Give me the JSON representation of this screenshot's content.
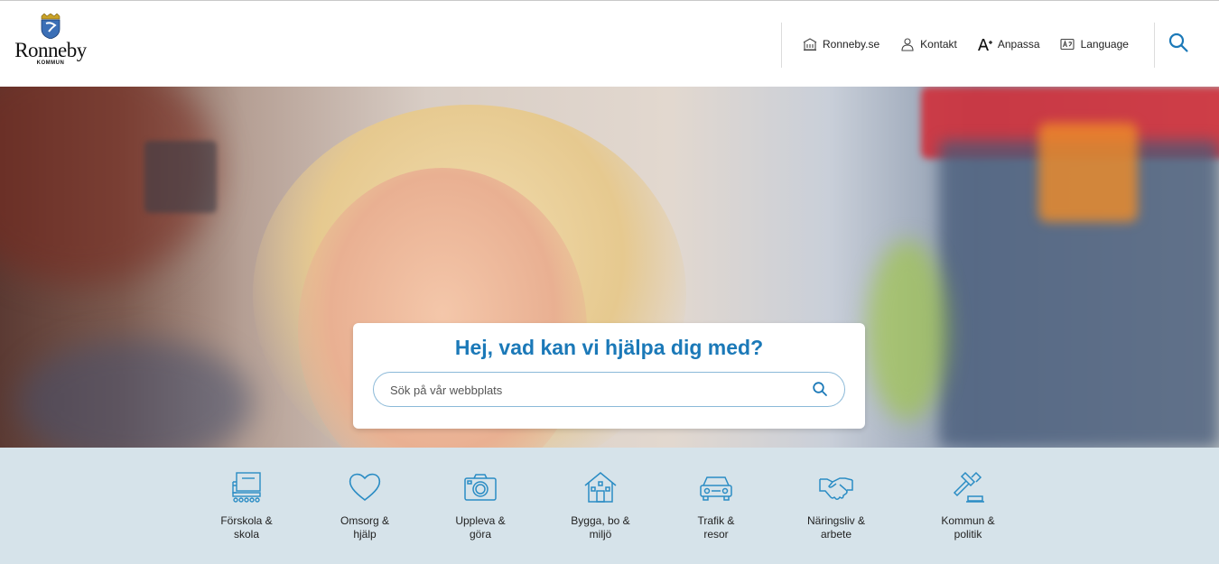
{
  "header": {
    "logo_name": "Ronneby",
    "logo_sub": "KOMMUN",
    "nav": [
      {
        "label": "Ronneby.se",
        "icon": "building-icon"
      },
      {
        "label": "Kontakt",
        "icon": "person-icon"
      },
      {
        "label": "Anpassa",
        "icon": "font-size-icon"
      },
      {
        "label": "Language",
        "icon": "language-icon"
      }
    ],
    "search_icon": "search-icon"
  },
  "hero": {
    "title": "Hej, vad kan vi hjälpa dig med?",
    "search_placeholder": "Sök på vår webbplats",
    "search_value": ""
  },
  "categories": [
    {
      "label": "Förskola &\nskola",
      "icon": "school-icon"
    },
    {
      "label": "Omsorg &\nhjälp",
      "icon": "heart-icon"
    },
    {
      "label": "Uppleva &\ngöra",
      "icon": "camera-icon"
    },
    {
      "label": "Bygga, bo &\nmiljö",
      "icon": "house-icon"
    },
    {
      "label": "Trafik &\nresor",
      "icon": "car-icon"
    },
    {
      "label": "Näringsliv &\narbete",
      "icon": "handshake-icon"
    },
    {
      "label": "Kommun &\npolitik",
      "icon": "gavel-icon"
    }
  ],
  "colors": {
    "accent": "#1b79b8",
    "category_bg": "#d6e3ea",
    "icon": "#2a8cc4"
  }
}
